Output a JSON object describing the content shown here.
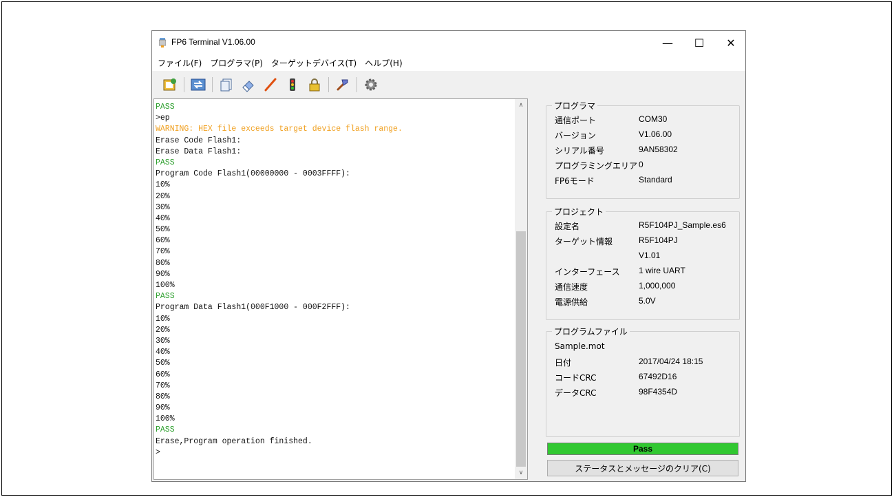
{
  "window": {
    "title": "FP6 Terminal V1.06.00",
    "minimize": "—",
    "maximize": "☐",
    "close": "✕"
  },
  "menu": [
    "ファイル(F)",
    "プログラマ(P)",
    "ターゲットデバイス(T)",
    "ヘルプ(H)"
  ],
  "toolbar_icons": [
    "open-settings-icon",
    "connect-icon",
    "blank-check-icon",
    "erase-icon",
    "program-icon",
    "verify-icon",
    "protect-icon",
    "autoprocedure-icon",
    "options-gear-icon"
  ],
  "console": {
    "lines": [
      {
        "text": "PASS",
        "color": "green"
      },
      {
        "text": ">ep",
        "color": "black"
      },
      {
        "text": "WARNING: HEX file exceeds target device flash range.",
        "color": "orange"
      },
      {
        "text": "Erase Code Flash1:",
        "color": "black"
      },
      {
        "text": "Erase Data Flash1:",
        "color": "black"
      },
      {
        "text": "PASS",
        "color": "green"
      },
      {
        "text": "Program Code Flash1(00000000 - 0003FFFF):",
        "color": "black"
      },
      {
        "text": "10%",
        "color": "black"
      },
      {
        "text": "20%",
        "color": "black"
      },
      {
        "text": "30%",
        "color": "black"
      },
      {
        "text": "40%",
        "color": "black"
      },
      {
        "text": "50%",
        "color": "black"
      },
      {
        "text": "60%",
        "color": "black"
      },
      {
        "text": "70%",
        "color": "black"
      },
      {
        "text": "80%",
        "color": "black"
      },
      {
        "text": "90%",
        "color": "black"
      },
      {
        "text": "100%",
        "color": "black"
      },
      {
        "text": "PASS",
        "color": "green"
      },
      {
        "text": "Program Data Flash1(000F1000 - 000F2FFF):",
        "color": "black"
      },
      {
        "text": "10%",
        "color": "black"
      },
      {
        "text": "20%",
        "color": "black"
      },
      {
        "text": "30%",
        "color": "black"
      },
      {
        "text": "40%",
        "color": "black"
      },
      {
        "text": "50%",
        "color": "black"
      },
      {
        "text": "60%",
        "color": "black"
      },
      {
        "text": "70%",
        "color": "black"
      },
      {
        "text": "80%",
        "color": "black"
      },
      {
        "text": "90%",
        "color": "black"
      },
      {
        "text": "100%",
        "color": "black"
      },
      {
        "text": "PASS",
        "color": "green"
      },
      {
        "text": "Erase,Program operation finished.",
        "color": "black"
      },
      {
        "text": ">",
        "color": "black"
      }
    ]
  },
  "programmer": {
    "title": "プログラマ",
    "rows": [
      {
        "label": "通信ポート",
        "value": "COM30"
      },
      {
        "label": "バージョン",
        "value": "V1.06.00"
      },
      {
        "label": "シリアル番号",
        "value": "9AN58302"
      },
      {
        "label": "プログラミングエリア",
        "value": "0"
      },
      {
        "label": "FP6モード",
        "value": "Standard"
      }
    ]
  },
  "project": {
    "title": "プロジェクト",
    "rows": [
      {
        "label": "設定名",
        "value": "R5F104PJ_Sample.es6"
      },
      {
        "label": "ターゲット情報",
        "value": "R5F104PJ"
      },
      {
        "label": "",
        "value": "V1.01"
      },
      {
        "label": "インターフェース",
        "value": "1 wire UART"
      },
      {
        "label": "通信速度",
        "value": "1,000,000"
      },
      {
        "label": "電源供給",
        "value": "5.0V"
      }
    ]
  },
  "program_file": {
    "title": "プログラムファイル",
    "filename": "Sample.mot",
    "rows": [
      {
        "label": "日付",
        "value": "2017/04/24 18:15"
      },
      {
        "label": "コードCRC",
        "value": "67492D16"
      },
      {
        "label": "データCRC",
        "value": "98F4354D"
      }
    ]
  },
  "status": {
    "text": "Pass",
    "color": "#31c831"
  },
  "clear_button": "ステータスとメッセージのクリア(C)"
}
